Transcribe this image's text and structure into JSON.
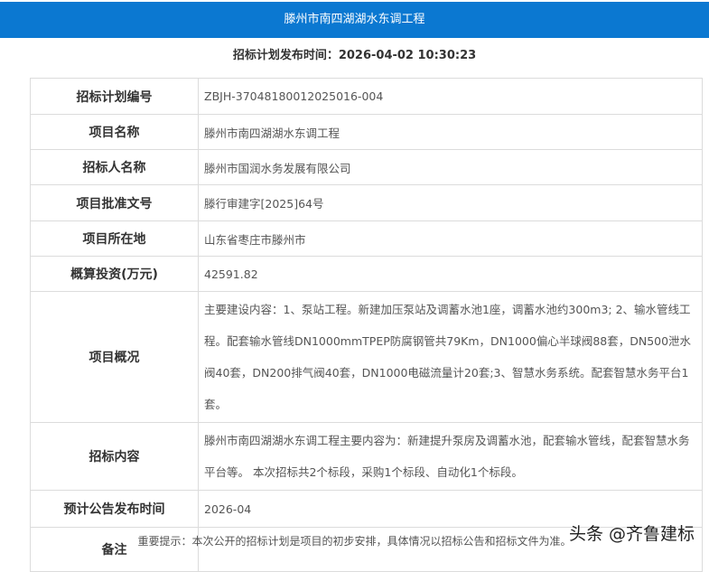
{
  "header": {
    "title": "滕州市南四湖湖水东调工程"
  },
  "publish": {
    "label": "招标计划发布时间：",
    "value": "2026-04-02 10:30:23"
  },
  "rows": [
    {
      "label": "招标计划编号",
      "value": "ZBJH-37048180012025016-004"
    },
    {
      "label": "项目名称",
      "value": "滕州市南四湖湖水东调工程"
    },
    {
      "label": "招标人名称",
      "value": "滕州市国润水务发展有限公司"
    },
    {
      "label": "项目批准文号",
      "value": "滕行审建字[2025]64号"
    },
    {
      "label": "项目所在地",
      "value": "山东省枣庄市滕州市"
    },
    {
      "label": "概算投资(万元)",
      "value": "42591.82"
    },
    {
      "label": "项目概况",
      "value": "主要建设内容：1、泵站工程。新建加压泵站及调蓄水池1座，调蓄水池约300m3; 2、输水管线工程。配套输水管线DN1000mmTPEP防腐钢管共79Km，DN1000偏心半球阀88套，DN500泄水阀40套，DN200排气阀40套，DN1000电磁流量计20套;3、智慧水务系统。配套智慧水务平台1套。"
    },
    {
      "label": "招标内容",
      "value": "滕州市南四湖湖水东调工程主要内容为：新建提升泵房及调蓄水池，配套输水管线，配套智慧水务平台等。 本次招标共2个标段，采购1个标段、自动化1个标段。"
    },
    {
      "label": "预计公告发布时间",
      "value": "2026-04"
    },
    {
      "label": "备注",
      "value": ""
    }
  ],
  "notice": "重要提示：本次公开的招标计划是项目的初步安排，具体情况以招标公告和招标文件为准。",
  "watermark": "头条 @齐鲁建标"
}
